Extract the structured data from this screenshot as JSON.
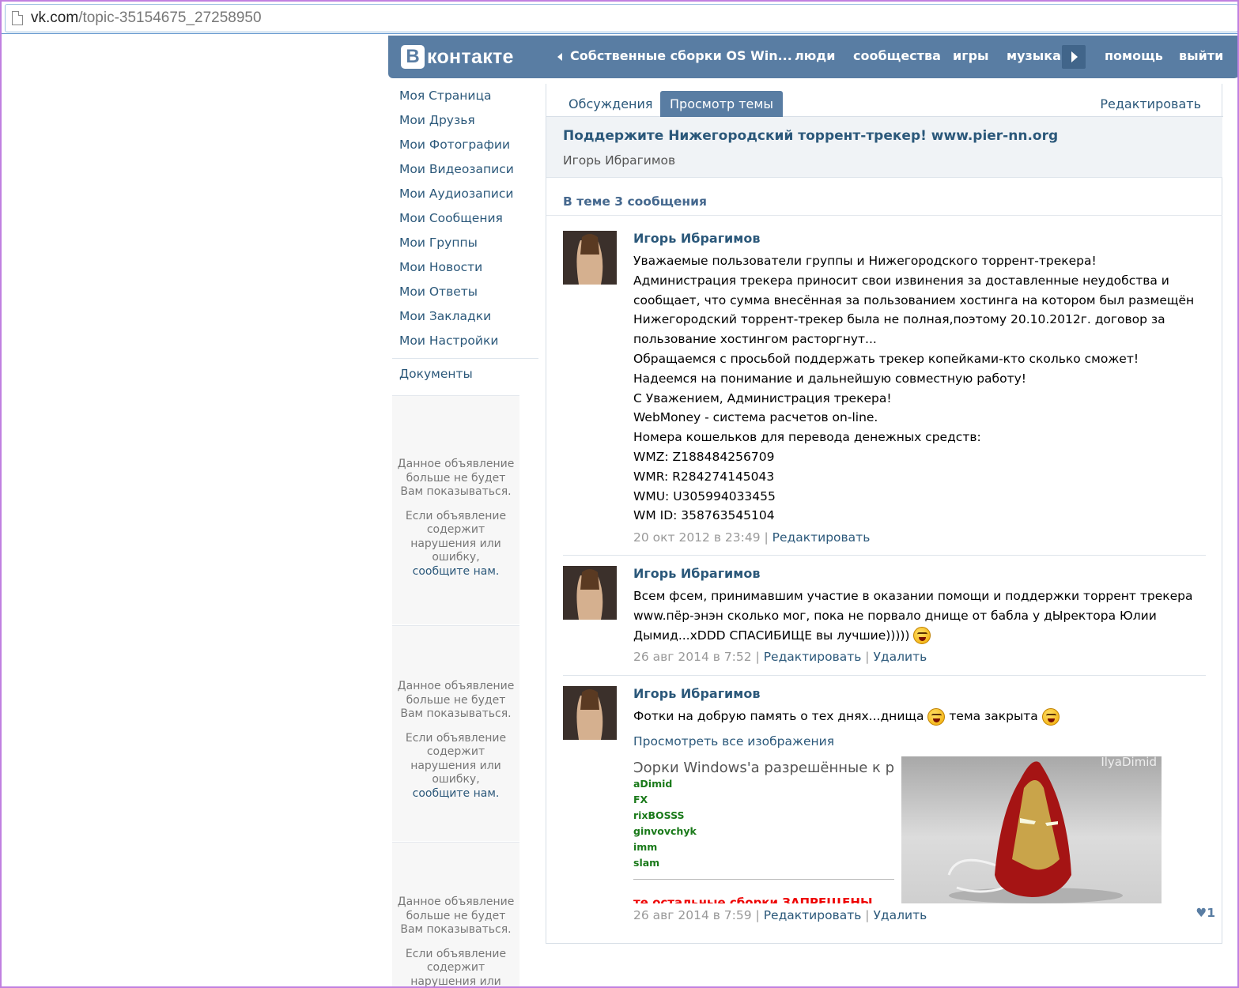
{
  "browser": {
    "url_host": "vk.com",
    "url_path": "/topic-35154675_27258950"
  },
  "header": {
    "logo_b": "B",
    "logo_text": "контакте",
    "back_label": "Собственные сборки OS Win...",
    "nav": [
      "люди",
      "сообщества",
      "игры",
      "музыка",
      "помощь",
      "выйти"
    ]
  },
  "sidebar": {
    "items": [
      "Моя Страница",
      "Мои Друзья",
      "Мои Фотографии",
      "Мои Видеозаписи",
      "Мои Аудиозаписи",
      "Мои Сообщения",
      "Мои Группы",
      "Мои Новости",
      "Мои Ответы",
      "Мои Закладки",
      "Мои Настройки"
    ],
    "documents": "Документы",
    "ad": {
      "hidden_text": "Данное объявление больше не будет Вам показываться.",
      "report_text": "Если объявление содержит нарушения или ошибку,",
      "report_link": "сообщите нам."
    }
  },
  "tabs": {
    "discussions": "Обсуждения",
    "view_topic": "Просмотр темы",
    "edit": "Редактировать"
  },
  "topic": {
    "title": "Поддержите Нижегородский торрент-трекер! www.pier-nn.org",
    "author": "Игорь Ибрагимов",
    "count_text": "В теме 3 сообщения"
  },
  "posts": [
    {
      "author": "Игорь Ибрагимов",
      "lines": [
        "Уважаемые пользователи группы и Нижегородского торрент-трекера!",
        "Администрация трекера приносит свои извинения за доставленные неудобства и",
        "сообщает, что сумма внесённая за пользованием хостинга на котором был размещён",
        "Нижегородский торрент-трекер была не полная,поэтому 20.10.2012г. договор за",
        "пользование хостингом расторгнут...",
        "Обращаемся с просьбой поддержать трекер копейками-кто сколько сможет!",
        "Надеемся на понимание и дальнейшую совместную работу!",
        "С Уважением, Администрация трекера!",
        "WebMoney - система расчетов on-line.",
        "Номера кошельков для перевода денежных средств:",
        "WMZ: Z188484256709",
        "WMR: R284274145043",
        "WMU: U305994033455",
        "WM ID: 358763545104"
      ],
      "date": "20 окт 2012 в 23:49",
      "edit": "Редактировать"
    },
    {
      "author": "Игорь Ибрагимов",
      "lines": [
        "Всем фсем, принимавшим участие в оказании помощи и поддержки торрент трекера",
        "www.пёр-энэн сколько мог, пока не порвало днище от бабла у дЫректора Юлии",
        "Дымид...xDDD СПАСИБИЩЕ вы лучшие)))))"
      ],
      "date": "26 авг 2014 в 7:52",
      "edit": "Редактировать",
      "delete": "Удалить"
    },
    {
      "author": "Игорь Ибрагимов",
      "text_a": "Фотки на добрую память о тех днях...днища",
      "text_b": "тема закрыта",
      "view_all": "Просмотреть все изображения",
      "image1": {
        "heading": "Ɔорки Windows'a разрешённые к раздаче",
        "names": [
          "aDimid",
          "FX",
          "rixBOSSS",
          "ginvovchyk",
          "imm",
          "slam"
        ],
        "red_text": "те остальные сборки ЗАПРЕЩЕНЫ"
      },
      "image2": {
        "watermark": "IlyaDimid"
      },
      "date": "26 авг 2014 в 7:59",
      "edit": "Редактировать",
      "delete": "Удалить",
      "likes": "1"
    }
  ],
  "colors": {
    "header_bg": "#597da3",
    "link": "#2b587a",
    "tab_active": "#597da3"
  }
}
